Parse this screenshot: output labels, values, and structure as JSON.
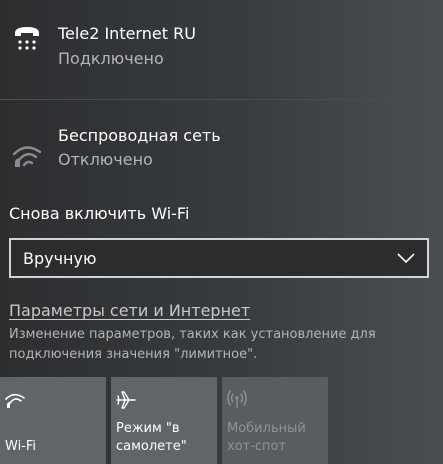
{
  "networks": [
    {
      "name": "Tele2 Internet RU",
      "status": "Подключено",
      "icon": "ethernet-icon"
    },
    {
      "name": "Беспроводная сеть",
      "status": "Отключено",
      "icon": "wifi-off-icon"
    }
  ],
  "reenable": {
    "label": "Снова включить Wi-Fi",
    "selected": "Вручную"
  },
  "settings": {
    "link": "Параметры сети и Интернет",
    "description": "Изменение параметров, таких как установление для подключения значения \"лимитное\"."
  },
  "quick_actions": [
    {
      "label": "Wi-Fi",
      "icon": "wifi-icon",
      "state": "off"
    },
    {
      "label": "Режим \"в\nсамолете\"",
      "icon": "airplane-icon",
      "state": "off"
    },
    {
      "label": "Мобильный\nхот-спот",
      "icon": "hotspot-icon",
      "state": "disabled"
    }
  ],
  "colors": {
    "text": "#ffffff",
    "secondary_text": "#b3b5b7",
    "tile_background": "#626568",
    "disabled_text": "#8f9396"
  }
}
